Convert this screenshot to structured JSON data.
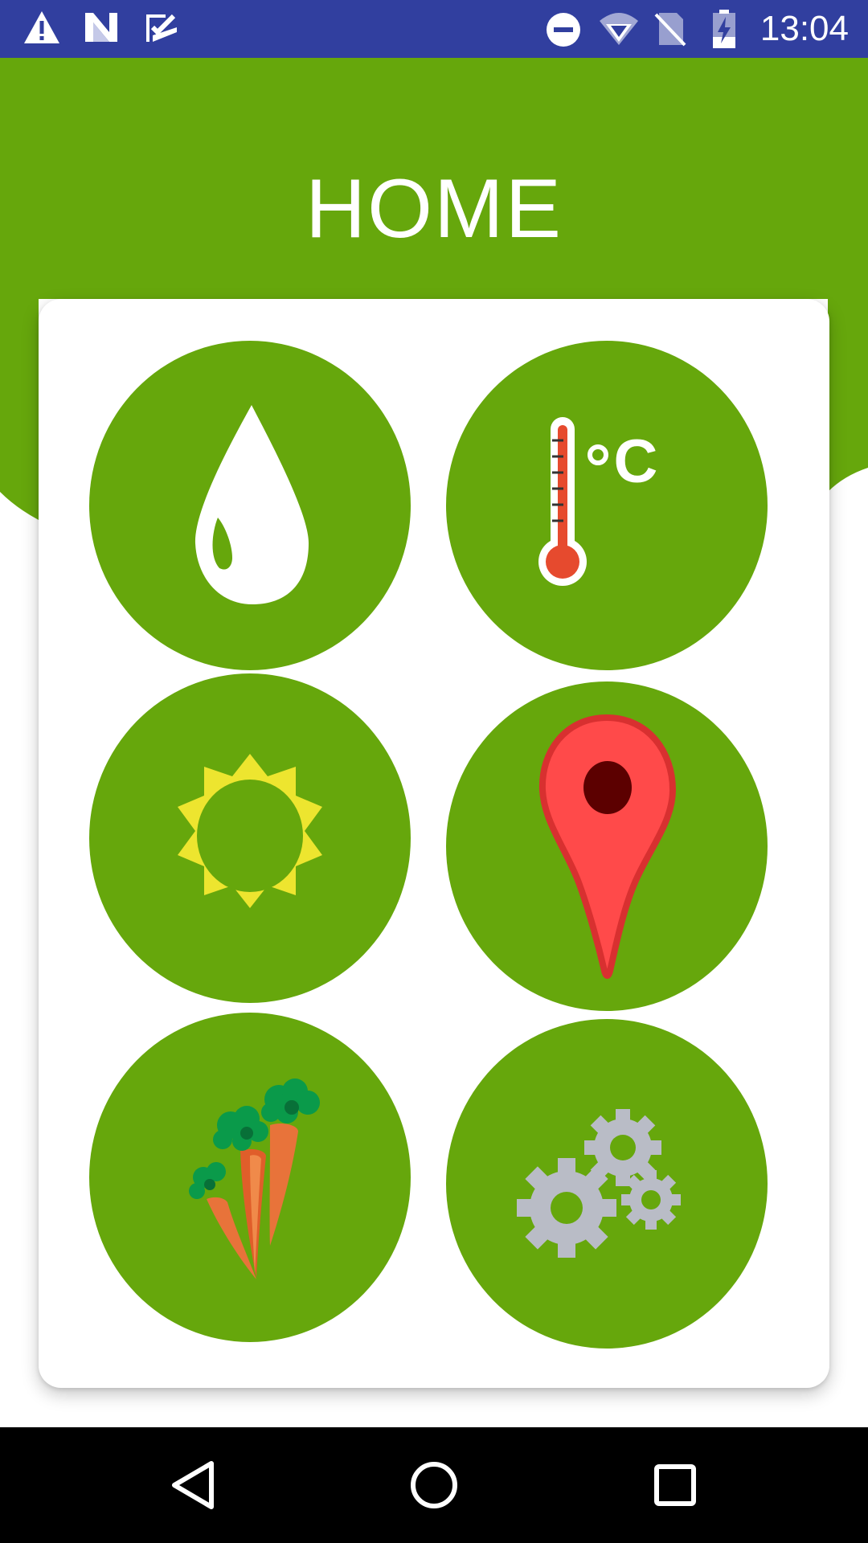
{
  "status_bar": {
    "time": "13:04",
    "left_icons": [
      "warning-icon",
      "n-notification-icon",
      "task-check-icon"
    ],
    "right_icons": [
      "do-not-disturb-icon",
      "wifi-icon",
      "no-sim-icon",
      "battery-charging-icon"
    ]
  },
  "header": {
    "title": "HOME",
    "color": "#66a70c"
  },
  "tiles": [
    {
      "icon": "water-drop-icon"
    },
    {
      "icon": "thermometer-icon",
      "label": "°C"
    },
    {
      "icon": "sun-icon"
    },
    {
      "icon": "map-pin-icon"
    },
    {
      "icon": "carrots-icon"
    },
    {
      "icon": "gears-icon"
    }
  ],
  "nav_bar": {
    "buttons": [
      "back-icon",
      "home-icon",
      "recents-icon"
    ]
  },
  "colors": {
    "status_bar": "#313f9f",
    "accent_green": "#66a70c",
    "sun_yellow": "#ede52f",
    "pin_red": "#ff4a4a",
    "carrot_orange": "#e8733a",
    "gear_gray": "#b9bcc6"
  }
}
